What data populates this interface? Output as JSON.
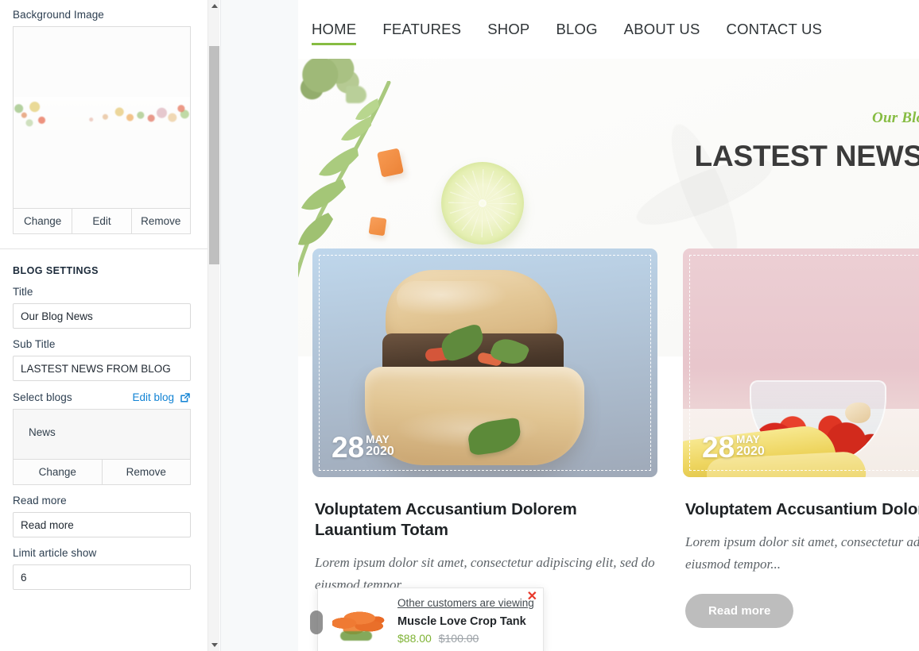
{
  "sidebar": {
    "background_image": {
      "label": "Background Image",
      "buttons": [
        "Change",
        "Edit",
        "Remove"
      ]
    },
    "blog_settings": {
      "heading": "BLOG SETTINGS",
      "title_label": "Title",
      "title_value": "Our Blog News",
      "subtitle_label": "Sub Title",
      "subtitle_value": "LASTEST NEWS FROM BLOG",
      "select_blogs_label": "Select blogs",
      "edit_blog_link": "Edit blog",
      "selected_blog": "News",
      "blog_buttons": [
        "Change",
        "Remove"
      ],
      "read_more_label": "Read more",
      "read_more_value": "Read more",
      "limit_label": "Limit article show",
      "limit_value": "6"
    }
  },
  "site": {
    "nav": [
      {
        "label": "HOME",
        "active": true
      },
      {
        "label": "FEATURES",
        "active": false
      },
      {
        "label": "SHOP",
        "active": false
      },
      {
        "label": "BLOG",
        "active": false
      },
      {
        "label": "ABOUT US",
        "active": false
      },
      {
        "label": "CONTACT US",
        "active": false
      }
    ],
    "hero": {
      "eyebrow": "Our Blog News",
      "title": "LASTEST NEWS FR"
    },
    "cards": [
      {
        "date_day": "28",
        "date_month": "MAY",
        "date_year": "2020",
        "title": "Voluptatem Accusantium Dolorem Lauantium Totam",
        "excerpt": "Lorem ipsum dolor sit amet, consectetur adipiscing elit, sed do eiusmod tempor..."
      },
      {
        "date_day": "28",
        "date_month": "MAY",
        "date_year": "2020",
        "title": "Voluptatem Accusantium Dolorem Totam",
        "excerpt": "Lorem ipsum dolor sit amet, consectetur adipiscing elit, sed do eiusmod tempor...",
        "read_more": "Read more"
      }
    ]
  },
  "notification": {
    "kicker": "Other customers are viewing",
    "product_name": "Muscle Love Crop Tank",
    "price_new": "$88.00",
    "price_old": "$100.00",
    "close": "✕"
  },
  "colors": {
    "accent_green": "#86bc42",
    "price_green": "#7fb335",
    "link_blue": "#1283d4",
    "close_red": "#e8392b",
    "button_gray": "#bdbdbd"
  }
}
